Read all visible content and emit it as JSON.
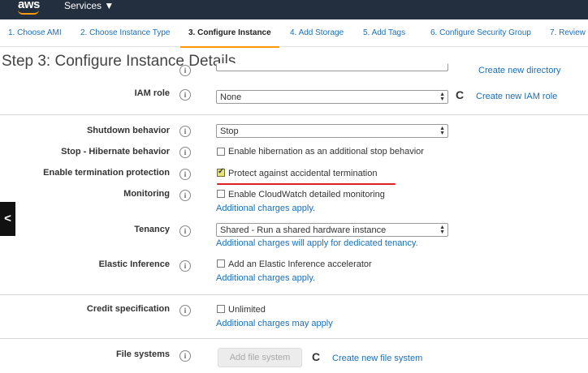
{
  "topbar": {
    "logo": "aws",
    "services_label": "Services ▼"
  },
  "wizard": {
    "steps": [
      {
        "label": "1. Choose AMI"
      },
      {
        "label": "2. Choose Instance Type"
      },
      {
        "label": "3. Configure Instance"
      },
      {
        "label": "4. Add Storage"
      },
      {
        "label": "5. Add Tags"
      },
      {
        "label": "6. Configure Security Group"
      },
      {
        "label": "7. Review"
      }
    ],
    "active_step": 3
  },
  "page": {
    "title": "Step 3: Configure Instance Details"
  },
  "form": {
    "top_link": "Create new directory",
    "iam_role": {
      "label": "IAM role",
      "value": "None",
      "link": "Create new IAM role"
    },
    "shutdown": {
      "label": "Shutdown behavior",
      "value": "Stop"
    },
    "hibernate": {
      "label": "Stop - Hibernate behavior",
      "checkbox": "Enable hibernation as an additional stop behavior",
      "checked": false
    },
    "termination": {
      "label": "Enable termination protection",
      "checkbox": "Protect against accidental termination",
      "checked": true
    },
    "monitoring": {
      "label": "Monitoring",
      "checkbox": "Enable CloudWatch detailed monitoring",
      "note": "Additional charges apply.",
      "checked": false
    },
    "tenancy": {
      "label": "Tenancy",
      "value": "Shared - Run a shared hardware instance",
      "note": "Additional charges will apply for dedicated tenancy."
    },
    "elastic_inference": {
      "label": "Elastic Inference",
      "checkbox": "Add an Elastic Inference accelerator",
      "note": "Additional charges apply.",
      "checked": false
    },
    "credit": {
      "label": "Credit specification",
      "checkbox": "Unlimited",
      "note": "Additional charges may apply",
      "checked": false
    },
    "file_systems": {
      "label": "File systems",
      "button": "Add file system",
      "link": "Create new file system"
    }
  },
  "icons": {
    "info": "i",
    "refresh": "C",
    "back": "<"
  },
  "colors": {
    "topbar": "#232f3e",
    "link": "#1b6fb8",
    "accent": "#ff9900",
    "annotation": "#e02020"
  }
}
